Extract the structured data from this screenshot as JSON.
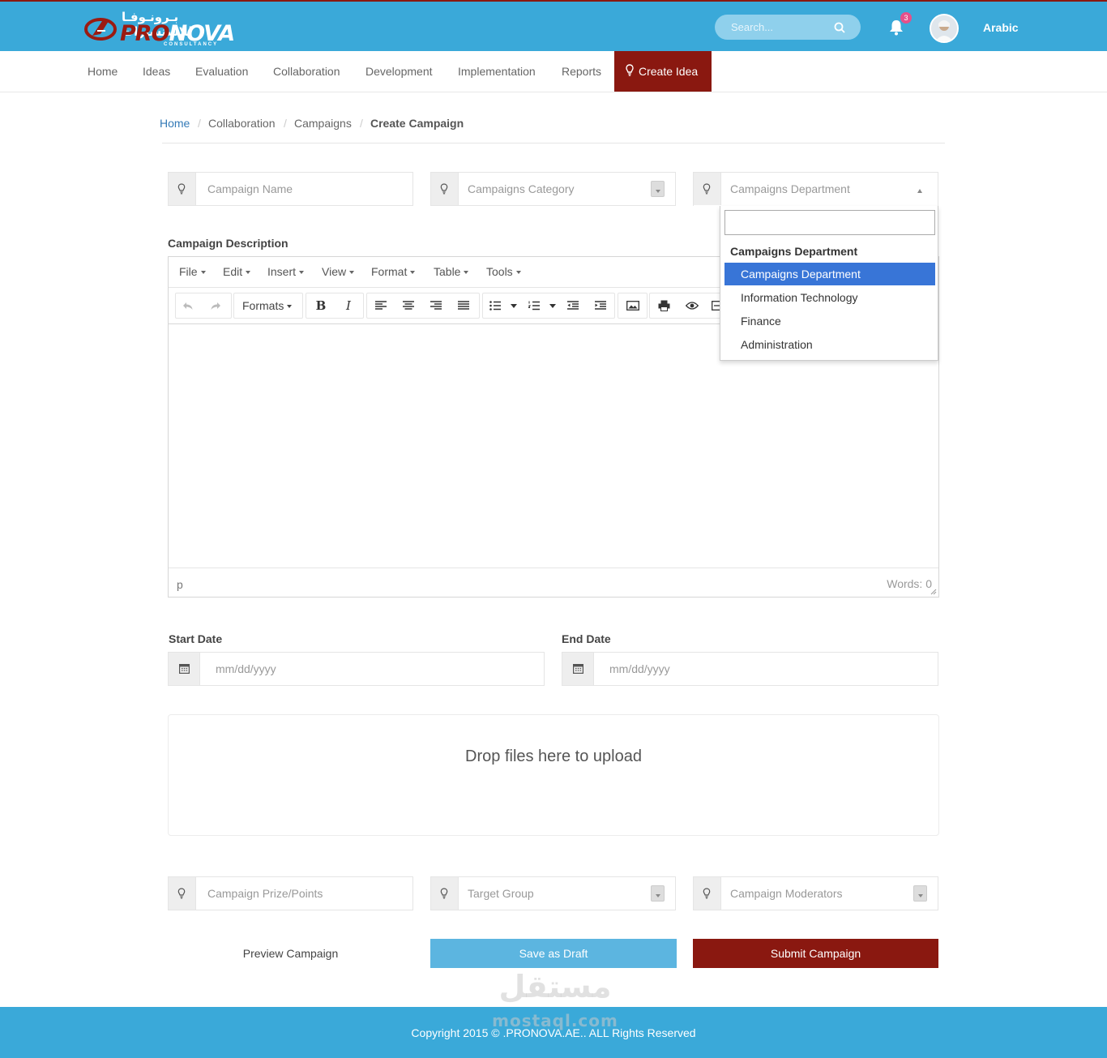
{
  "header": {
    "logo_arabic": "بـرونـوفـا للاستشارات",
    "logo_pro": "PRO",
    "logo_nova": "NOVA",
    "logo_sub": "CONSULTANCY",
    "search_placeholder": "Search...",
    "notification_count": "3",
    "language": "Arabic"
  },
  "nav": {
    "items": [
      "Home",
      "Ideas",
      "Evaluation",
      "Collaboration",
      "Development",
      "Implementation",
      "Reports"
    ],
    "cta_label": "Create Idea"
  },
  "breadcrumb": {
    "items": [
      "Home",
      "Collaboration",
      "Campaigns",
      "Create Campaign"
    ],
    "separator": "/"
  },
  "form": {
    "campaign_name_placeholder": "Campaign Name",
    "category_placeholder": "Campaigns Category",
    "department_placeholder": "Campaigns Department",
    "description_label": "Campaign Description",
    "start_date_label": "Start Date",
    "end_date_label": "End Date",
    "date_placeholder": "mm/dd/yyyy",
    "prize_placeholder": "Campaign Prize/Points",
    "target_group_placeholder": "Target Group",
    "moderators_placeholder": "Campaign Moderators"
  },
  "department_dropdown": {
    "search_value": "",
    "group_label": "Campaigns Department",
    "options": [
      "Campaigns Department",
      "Information Technology",
      "Finance",
      "Administration"
    ],
    "highlighted_index": 0
  },
  "editor": {
    "menus": [
      "File",
      "Edit",
      "Insert",
      "View",
      "Format",
      "Table",
      "Tools"
    ],
    "formats_label": "Formats",
    "bold_glyph": "B",
    "italic_glyph": "I",
    "status_path": "p",
    "word_count": "Words: 0"
  },
  "dropzone": {
    "message": "Drop files here to upload"
  },
  "actions": {
    "preview_label": "Preview Campaign",
    "draft_label": "Save as Draft",
    "submit_label": "Submit Campaign"
  },
  "footer": {
    "copyright": "Copyright 2015 © .PRONOVA.AE.. ALL Rights Reserved"
  },
  "watermark": {
    "arabic": "مستقل",
    "latin": "mostaql.com"
  },
  "colors": {
    "header_bg": "#3aa9d9",
    "brand_red": "#8a1810",
    "draft_button": "#5cb5e0",
    "dropdown_highlight": "#3875d7",
    "badge": "#e5508a"
  },
  "icons": {
    "search": "search-icon",
    "bell": "bell-icon",
    "bulb": "lightbulb-icon",
    "calendar": "calendar-icon"
  }
}
